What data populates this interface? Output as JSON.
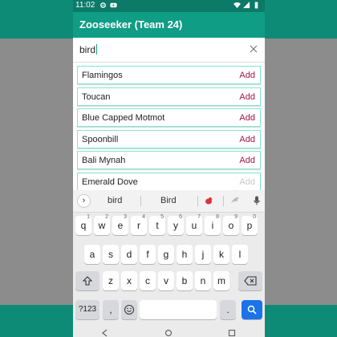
{
  "status_bar": {
    "time": "11:02"
  },
  "app_bar": {
    "title": "Zooseeker (Team 24)"
  },
  "search": {
    "query": "bird"
  },
  "results": [
    {
      "name": "Flamingos",
      "action": "Add"
    },
    {
      "name": "Toucan",
      "action": "Add"
    },
    {
      "name": "Blue Capped Motmot",
      "action": "Add"
    },
    {
      "name": "Spoonbill",
      "action": "Add"
    },
    {
      "name": "Bali Mynah",
      "action": "Add"
    },
    {
      "name": "Emerald Dove",
      "action": "Add"
    }
  ],
  "keyboard": {
    "suggestions": [
      "bird",
      "Bird"
    ],
    "row1": [
      "q",
      "w",
      "e",
      "r",
      "t",
      "y",
      "u",
      "i",
      "o",
      "p"
    ],
    "row1_sup": [
      "1",
      "2",
      "3",
      "4",
      "5",
      "6",
      "7",
      "8",
      "9",
      "0"
    ],
    "row2": [
      "a",
      "s",
      "d",
      "f",
      "g",
      "h",
      "j",
      "k",
      "l"
    ],
    "row3": [
      "z",
      "x",
      "c",
      "v",
      "b",
      "n",
      "m"
    ],
    "symbols_label": "?123",
    "comma": ",",
    "period": "."
  },
  "colors": {
    "accent": "#109d86",
    "add_text": "#a31545",
    "enter_key": "#1a73e8"
  }
}
